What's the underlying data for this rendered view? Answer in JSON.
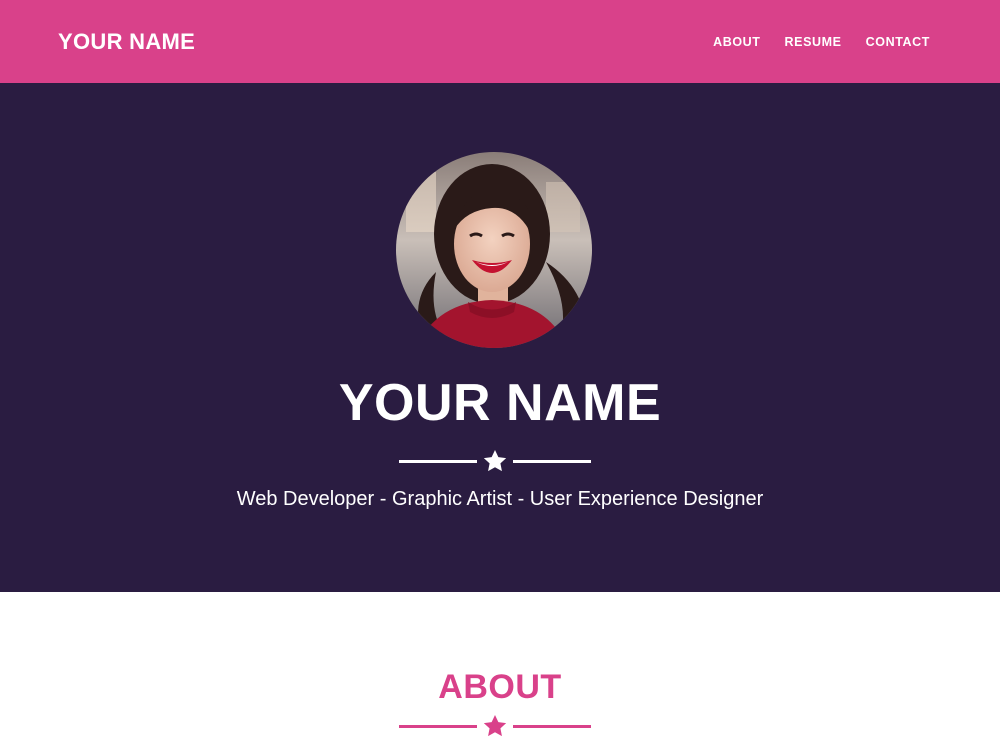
{
  "navbar": {
    "brand": "YOUR NAME",
    "links": [
      "ABOUT",
      "RESUME",
      "CONTACT"
    ]
  },
  "masthead": {
    "heading": "YOUR NAME",
    "subheading": "Web Developer - Graphic Artist - User Experience Designer"
  },
  "about": {
    "heading": "ABOUT"
  },
  "icons": {
    "divider": "star-icon"
  },
  "colors": {
    "primary": "#d9418a",
    "masthead_bg": "#2a1c41",
    "text_light": "#ffffff"
  }
}
